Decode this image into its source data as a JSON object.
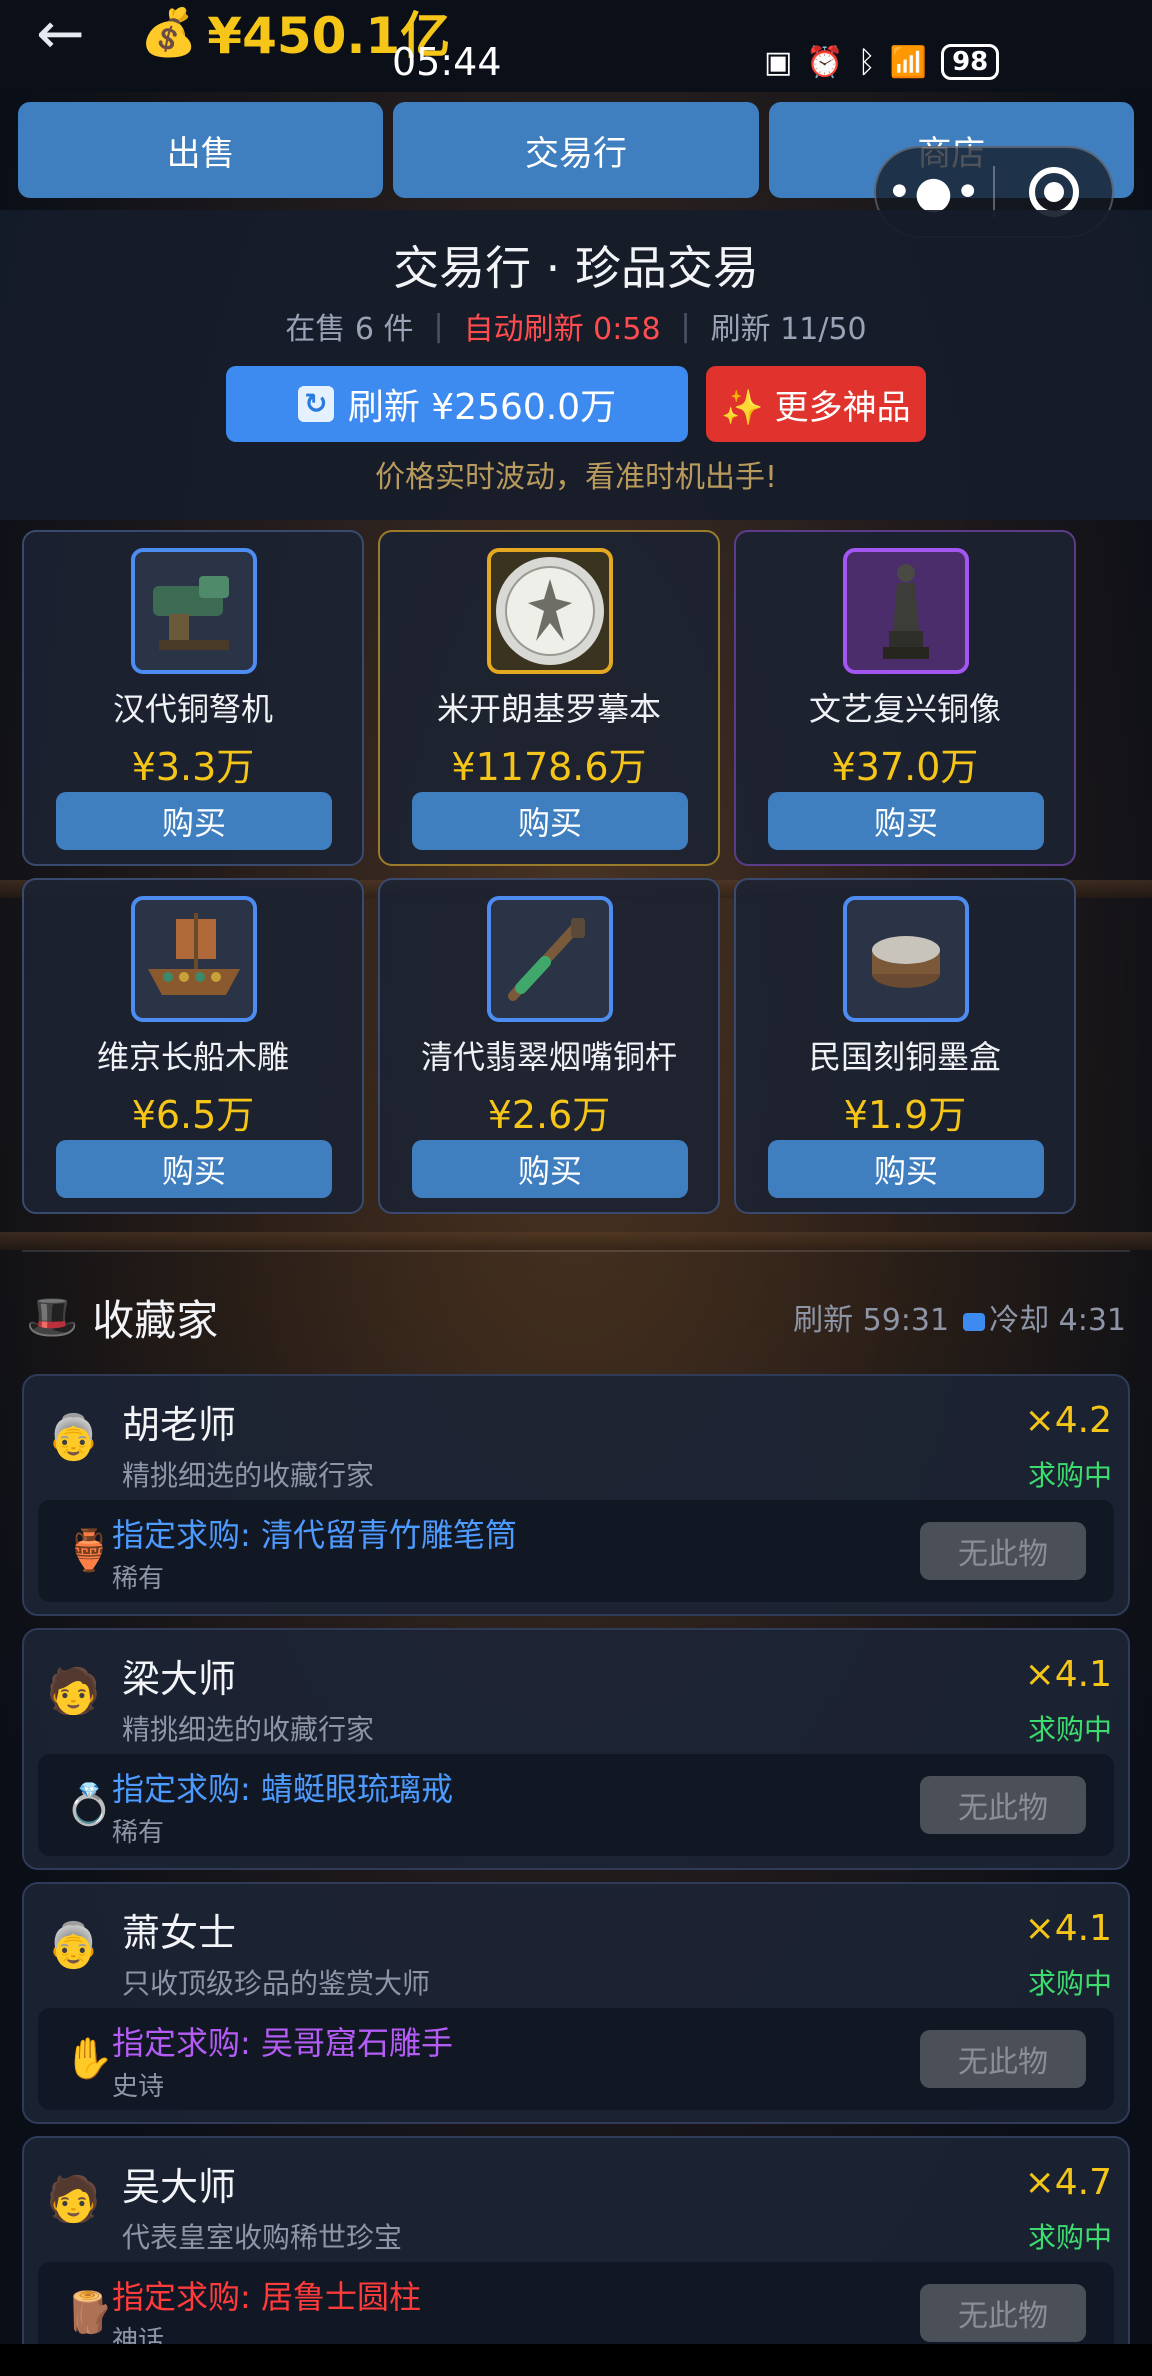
{
  "status_bar": {
    "money_icon": "money-bag",
    "money": "¥450.1亿",
    "time": "05:44",
    "battery": "98"
  },
  "tabs": [
    {
      "label": "出售"
    },
    {
      "label": "交易行"
    },
    {
      "label": "商店"
    }
  ],
  "header": {
    "title": "交易行 · 珍品交易",
    "on_sale": "在售 6 件",
    "auto_refresh": "自动刷新 0:58",
    "refresh_count": "刷新 11/50",
    "refresh_button": "刷新 ¥2560.0万",
    "more_button": "✨ 更多神品",
    "tip": "价格实时波动，看准时机出手!"
  },
  "items": [
    {
      "name": "汉代铜弩机",
      "price": "¥3.3万",
      "buy": "购买",
      "rarity_color": "#4d8cf0"
    },
    {
      "name": "米开朗基罗摹本",
      "price": "¥1178.6万",
      "buy": "购买",
      "rarity_color": "#e4a920"
    },
    {
      "name": "文艺复兴铜像",
      "price": "¥37.0万",
      "buy": "购买",
      "rarity_color": "#a457f0"
    },
    {
      "name": "维京长船木雕",
      "price": "¥6.5万",
      "buy": "购买",
      "rarity_color": "#4d8cf0"
    },
    {
      "name": "清代翡翠烟嘴铜杆",
      "price": "¥2.6万",
      "buy": "购买",
      "rarity_color": "#4d8cf0"
    },
    {
      "name": "民国刻铜墨盒",
      "price": "¥1.9万",
      "buy": "购买",
      "rarity_color": "#4d8cf0"
    }
  ],
  "collectors_section": {
    "title": "收藏家",
    "refresh": "刷新 59:31",
    "cooldown": "冷却 4:31"
  },
  "collectors": [
    {
      "name": "胡老师",
      "desc": "精挑细选的收藏行家",
      "multiplier": "×4.2",
      "status": "求购中",
      "request": "指定求购: 清代留青竹雕笔筒",
      "rarity": "稀有",
      "request_color": "#4d9bff",
      "button": "无此物"
    },
    {
      "name": "梁大师",
      "desc": "精挑细选的收藏行家",
      "multiplier": "×4.1",
      "status": "求购中",
      "request": "指定求购: 蜻蜓眼琉璃戒",
      "rarity": "稀有",
      "request_color": "#4d9bff",
      "button": "无此物"
    },
    {
      "name": "萧女士",
      "desc": "只收顶级珍品的鉴赏大师",
      "multiplier": "×4.1",
      "status": "求购中",
      "request": "指定求购: 吴哥窟石雕手",
      "rarity": "史诗",
      "request_color": "#b45cf5",
      "button": "无此物"
    },
    {
      "name": "吴大师",
      "desc": "代表皇室收购稀世珍宝",
      "multiplier": "×4.7",
      "status": "求购中",
      "request": "指定求购: 居鲁士圆柱",
      "rarity": "神话",
      "request_color": "#ff3b3b",
      "button": "无此物"
    }
  ]
}
